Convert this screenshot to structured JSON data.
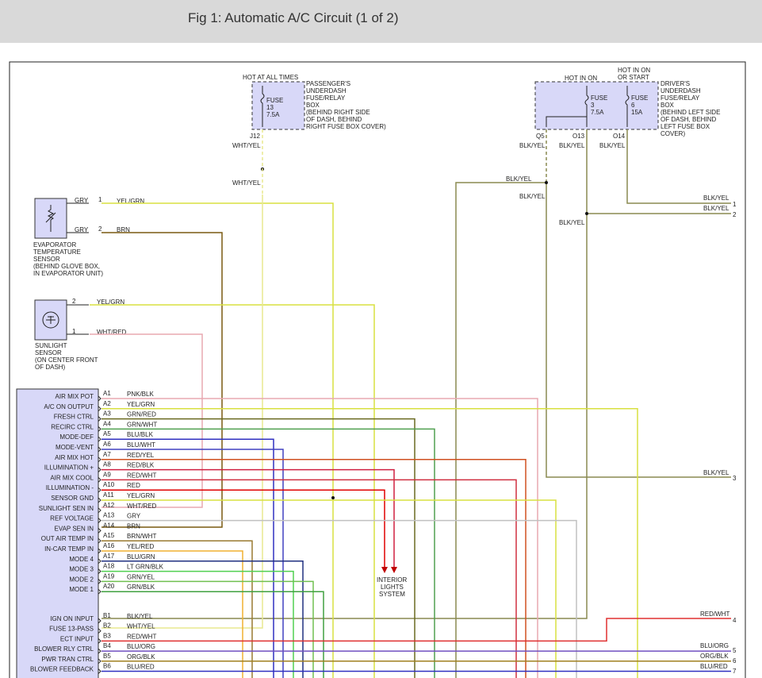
{
  "header": {
    "title": "Fig 1: Automatic A/C Circuit (1 of 2)"
  },
  "fuse_boxes": {
    "passenger": {
      "hot_label": "HOT AT ALL TIMES",
      "fuse_label": "FUSE",
      "fuse_number": "13",
      "fuse_amp": "7.5A",
      "description": [
        "PASSENGER'S",
        "UNDERDASH",
        "FUSE/RELAY",
        "BOX",
        "(BEHIND RIGHT SIDE",
        "OF DASH, BEHIND",
        "RIGHT FUSE BOX COVER)"
      ],
      "terminal": "J12",
      "wire1": "WHT/YEL",
      "wire2": "WHT/YEL"
    },
    "driver": {
      "hot_in_on": "HOT IN ON",
      "hot_on_start_1": "HOT IN ON",
      "hot_on_start_2": "OR START",
      "fuse3_label": "FUSE",
      "fuse3_number": "3",
      "fuse3_amp": "7.5A",
      "fuse6_label": "FUSE",
      "fuse6_number": "6",
      "fuse6_amp": "15A",
      "description": [
        "DRIVER'S",
        "UNDERDASH",
        "FUSE/RELAY",
        "BOX",
        "(BEHIND LEFT SIDE",
        "OF DASH, BEHIND",
        "LEFT FUSE BOX",
        "COVER)"
      ],
      "terminals": [
        "Q5",
        "O13",
        "O14"
      ],
      "wires": [
        "BLK/YEL",
        "BLK/YEL",
        "BLK/YEL"
      ]
    }
  },
  "sensors": {
    "evaporator": {
      "label": [
        "EVAPORATOR",
        "TEMPERATURE",
        "SENSOR",
        "(BEHIND GLOVE BOX,",
        "IN EVAPORATOR UNIT)"
      ],
      "pin1_wire": "GRY",
      "pin1_num": "1",
      "pin1_out": "YEL/GRN",
      "pin2_wire": "GRY",
      "pin2_num": "2",
      "pin2_out": "BRN"
    },
    "sunlight": {
      "label": [
        "SUNLIGHT",
        "SENSOR",
        "(ON CENTER FRONT",
        "OF DASH)"
      ],
      "pin2_num": "2",
      "pin2_out": "YEL/GRN",
      "pin1_num": "1",
      "pin1_out": "WHT/RED"
    }
  },
  "wire_labels": {
    "blk_yel_a": "BLK/YEL",
    "blk_yel_b": "BLK/YEL",
    "blk_yel_c": "BLK/YEL",
    "right_1": "BLK/YEL",
    "right_2": "BLK/YEL",
    "right_3": "BLK/YEL",
    "right_4": "RED/WHT",
    "right_5": "BLU/ORG",
    "right_6": "ORG/BLK",
    "right_7": "BLU/RED",
    "num_1": "1",
    "num_2": "2",
    "num_3": "3",
    "num_4": "4",
    "num_5": "5",
    "num_6": "6",
    "num_7": "7"
  },
  "interior_lights": [
    "INTERIOR",
    "LIGHTS",
    "SYSTEM"
  ],
  "module_pins": [
    {
      "name": "AIR MIX POT",
      "pin": "A1",
      "wire": "PNK/BLK",
      "color": "#e8a8b0"
    },
    {
      "name": "A/C ON OUTPUT",
      "pin": "A2",
      "wire": "YEL/GRN",
      "color": "#d8e040"
    },
    {
      "name": "FRESH CTRL",
      "pin": "A3",
      "wire": "GRN/RED",
      "color": "#6a6a20"
    },
    {
      "name": "RECIRC CTRL",
      "pin": "A4",
      "wire": "GRN/WHT",
      "color": "#50a050"
    },
    {
      "name": "MODE-DEF",
      "pin": "A5",
      "wire": "BLU/BLK",
      "color": "#3030c0"
    },
    {
      "name": "MODE-VENT",
      "pin": "A6",
      "wire": "BLU/WHT",
      "color": "#4040c0"
    },
    {
      "name": "AIR MIX HOT",
      "pin": "A7",
      "wire": "RED/YEL",
      "color": "#d05020"
    },
    {
      "name": "ILLUMINATION +",
      "pin": "A8",
      "wire": "RED/BLK",
      "color": "#d02040"
    },
    {
      "name": "AIR MIX COOL",
      "pin": "A9",
      "wire": "RED/WHT",
      "color": "#d03040"
    },
    {
      "name": "ILLUMINATION -",
      "pin": "A10",
      "wire": "RED",
      "color": "#e00000"
    },
    {
      "name": "SENSOR GND",
      "pin": "A11",
      "wire": "YEL/GRN",
      "color": "#d8e040"
    },
    {
      "name": "SUNLIGHT SEN IN",
      "pin": "A12",
      "wire": "WHT/RED",
      "color": "#e8a8b0"
    },
    {
      "name": "REF VOLTAGE",
      "pin": "A13",
      "wire": "GRY",
      "color": "#c0c0c0"
    },
    {
      "name": "EVAP SEN IN",
      "pin": "A14",
      "wire": "BRN",
      "color": "#7a5a10"
    },
    {
      "name": "OUT AIR TEMP IN",
      "pin": "A15",
      "wire": "BRN/WHT",
      "color": "#9a7a30"
    },
    {
      "name": "IN-CAR TEMP IN",
      "pin": "A16",
      "wire": "YEL/RED",
      "color": "#f0b030"
    },
    {
      "name": "MODE 4",
      "pin": "A17",
      "wire": "BLU/GRN",
      "color": "#203080"
    },
    {
      "name": "MODE 3",
      "pin": "A18",
      "wire": "LT GRN/BLK",
      "color": "#50d050"
    },
    {
      "name": "MODE 2",
      "pin": "A19",
      "wire": "GRN/YEL",
      "color": "#70c050"
    },
    {
      "name": "MODE 1",
      "pin": "A20",
      "wire": "GRN/BLK",
      "color": "#40a040"
    },
    {
      "name": "IGN ON INPUT",
      "pin": "B1",
      "wire": "BLK/YEL",
      "color": "#8a8a40"
    },
    {
      "name": "FUSE 13-PASS",
      "pin": "B2",
      "wire": "WHT/YEL",
      "color": "#e8e890"
    },
    {
      "name": "ECT INPUT",
      "pin": "B3",
      "wire": "RED/WHT",
      "color": "#e03030"
    },
    {
      "name": "BLOWER RLY CTRL",
      "pin": "B4",
      "wire": "BLU/ORG",
      "color": "#7050c0"
    },
    {
      "name": "PWR TRAN CTRL",
      "pin": "B5",
      "wire": "ORG/BLK",
      "color": "#a08020"
    },
    {
      "name": "BLOWER FEEDBACK",
      "pin": "B6",
      "wire": "BLU/RED",
      "color": "#3030c0"
    }
  ],
  "colors": {
    "fuse_box_fill": "#d8d8f8",
    "module_fill": "#d8d8f8",
    "blk_yel": "#8a8a50",
    "header_bg": "#d9d9d9"
  }
}
